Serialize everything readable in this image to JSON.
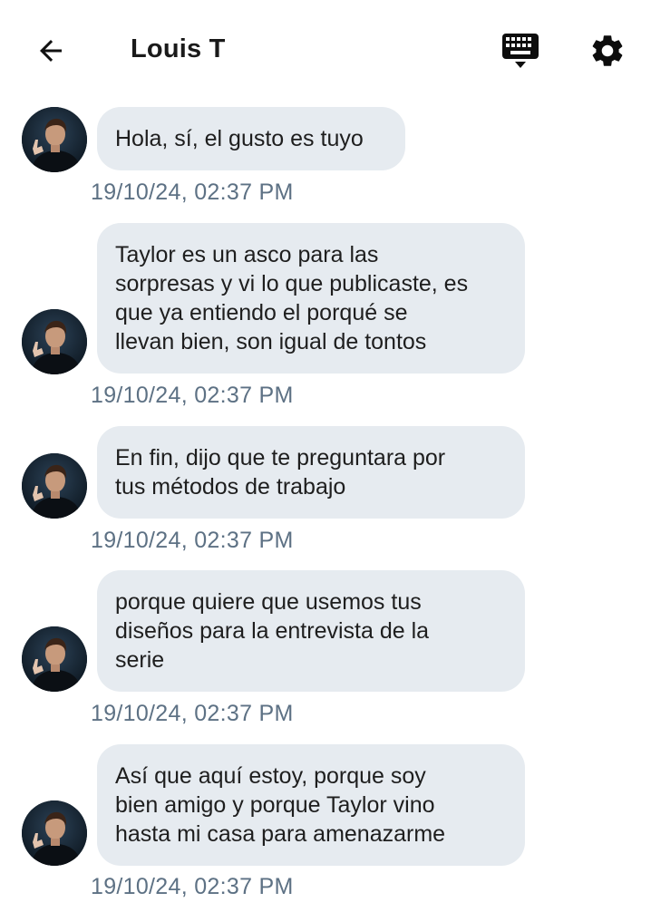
{
  "header": {
    "title": "Louis T",
    "back_icon": "arrow-left-icon",
    "keyboard_icon": "keyboard-icon",
    "settings_icon": "gear-icon"
  },
  "colors": {
    "bubble_bg": "#e6ebf0",
    "timestamp": "#5d7184",
    "text": "#1e1e1e"
  },
  "messages": [
    {
      "text": "Hola, sí, el gusto es tuyo",
      "time": "19/10/24, 02:37 PM"
    },
    {
      "text": "Taylor es un asco para las sorpresas y vi lo que publicaste, es que ya entiendo el porqué se llevan bien, son igual de tontos",
      "time": "19/10/24, 02:37 PM"
    },
    {
      "text": "En fin, dijo que te preguntara por tus métodos de trabajo",
      "time": "19/10/24, 02:37 PM"
    },
    {
      "text": "porque quiere que usemos tus diseños para la entrevista de la serie",
      "time": "19/10/24, 02:37 PM"
    },
    {
      "text": "Así que aquí estoy, porque soy bien amigo y porque Taylor vino hasta mi casa para amenazarme",
      "time": "19/10/24, 02:37 PM"
    }
  ]
}
